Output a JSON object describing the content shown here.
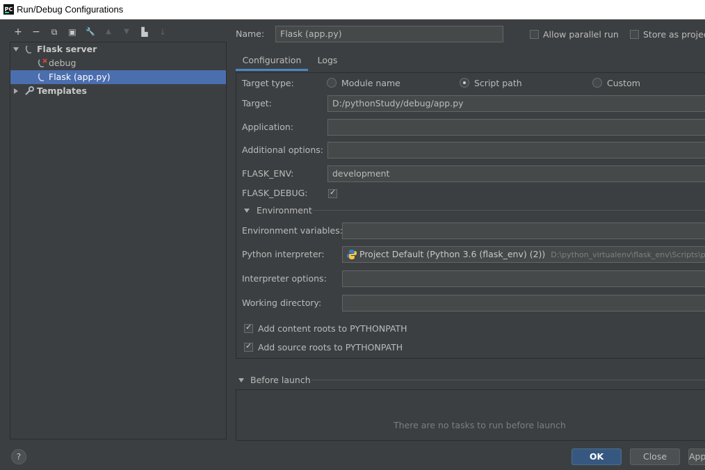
{
  "window": {
    "title": "Run/Debug Configurations",
    "logo_text": "PC"
  },
  "toolbar": {
    "add": "+",
    "remove": "−",
    "copy": "⧉",
    "save": "▣",
    "edit": "🔧",
    "up": "▲",
    "down": "▼",
    "folder": "▙",
    "sort": "↓"
  },
  "tree": {
    "root": "Flask server",
    "children": [
      "debug",
      "Flask (app.py)"
    ],
    "templates": "Templates"
  },
  "header": {
    "name_label": "Name:",
    "name_value": "Flask (app.py)",
    "allow_parallel": "Allow parallel run",
    "store_as": "Store as project file"
  },
  "tabs": [
    "Configuration",
    "Logs"
  ],
  "config": {
    "target_type_label": "Target type:",
    "target_types": [
      "Module name",
      "Script path",
      "Custom"
    ],
    "target_label": "Target:",
    "target_value": "D:/pythonStudy/debug/app.py",
    "application_label": "Application:",
    "application_value": "",
    "additional_label": "Additional options:",
    "additional_value": "",
    "flask_env_label": "FLASK_ENV:",
    "flask_env_value": "development",
    "flask_debug_label": "FLASK_DEBUG:",
    "environment_label": "Environment",
    "env_vars_label": "Environment variables:",
    "interpreter_label": "Python interpreter:",
    "interpreter_value": "Project Default (Python 3.6 (flask_env) (2))",
    "interpreter_path": "D:\\python_virtualenv\\flask_env\\Scripts\\python.exe",
    "interpreter_options_label": "Interpreter options:",
    "working_dir_label": "Working directory:",
    "content_roots": "Add content roots to PYTHONPATH",
    "source_roots": "Add source roots to PYTHONPATH"
  },
  "before_launch": {
    "label": "Before launch",
    "empty": "There are no tasks to run before launch"
  },
  "footer": {
    "help": "?",
    "ok": "OK",
    "close": "Close",
    "apply": "Apply"
  }
}
